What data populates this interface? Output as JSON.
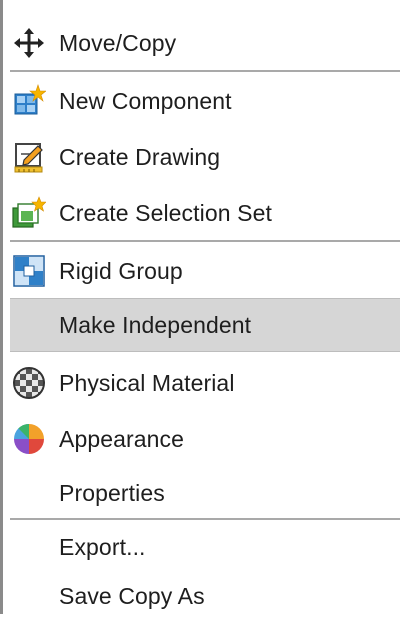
{
  "menu": {
    "items": [
      {
        "label": "Move/Copy",
        "icon": "move-icon"
      },
      {
        "label": "New Component",
        "icon": "new-component-icon"
      },
      {
        "label": "Create Drawing",
        "icon": "create-drawing-icon"
      },
      {
        "label": "Create Selection Set",
        "icon": "selection-set-icon"
      },
      {
        "label": "Rigid Group",
        "icon": "rigid-group-icon"
      },
      {
        "label": "Make Independent",
        "icon": ""
      },
      {
        "label": "Physical Material",
        "icon": "physical-material-icon"
      },
      {
        "label": "Appearance",
        "icon": "appearance-icon"
      },
      {
        "label": "Properties",
        "icon": ""
      },
      {
        "label": "Export...",
        "icon": ""
      },
      {
        "label": "Save Copy As",
        "icon": ""
      }
    ],
    "highlighted_item": "Make Independent"
  },
  "colors": {
    "highlight": "#d6d6d6",
    "separator": "#a9a9a9",
    "text": "#1e1e1e"
  }
}
